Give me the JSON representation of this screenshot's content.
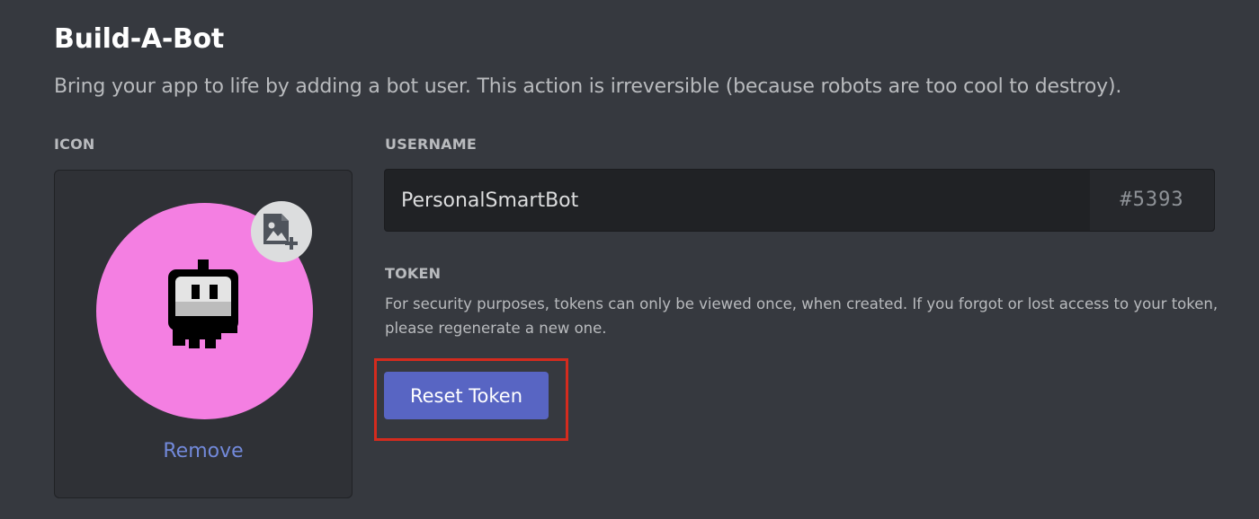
{
  "header": {
    "title": "Build-A-Bot",
    "subtitle": "Bring your app to life by adding a bot user. This action is irreversible (because robots are too cool to destroy)."
  },
  "icon_section": {
    "label": "ICON",
    "avatar_color": "#f47fe2",
    "avatar_icon": "robot-icon",
    "upload_icon": "image-add-icon",
    "remove_label": "Remove"
  },
  "username_section": {
    "label": "USERNAME",
    "value": "PersonalSmartBot",
    "discriminator": "#5393"
  },
  "token_section": {
    "label": "TOKEN",
    "description": "For security purposes, tokens can only be viewed once, when created. If you forgot or lost access to your token, please regenerate a new one.",
    "reset_label": "Reset Token"
  },
  "colors": {
    "background": "#36393f",
    "panel": "#2f3136",
    "input": "#202225",
    "accent": "#5865c3",
    "link": "#7289da",
    "highlight": "#d42b1e"
  }
}
